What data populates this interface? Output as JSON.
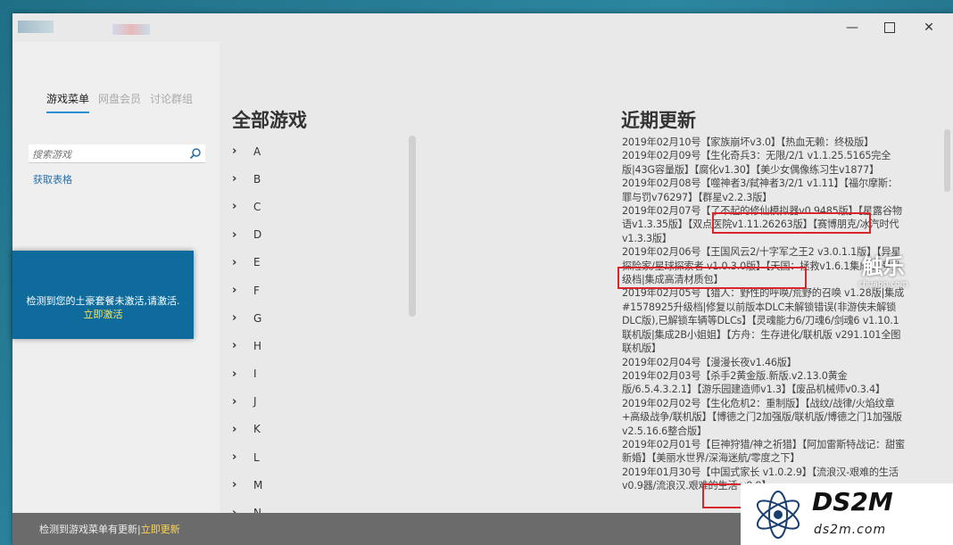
{
  "window": {
    "controls": {
      "minimize": "—",
      "close": "✕"
    }
  },
  "sidebar": {
    "tabs": [
      {
        "label": "游戏菜单",
        "active": true
      },
      {
        "label": "网盘会员",
        "active": false
      },
      {
        "label": "讨论群组",
        "active": false
      }
    ],
    "search_placeholder": "搜索游戏",
    "get_table_label": "获取表格",
    "activation": {
      "message": "检测到您的土豪套餐未激活,请激活.",
      "link": "立即激活"
    }
  },
  "games": {
    "title": "全部游戏",
    "letters": [
      "A",
      "B",
      "C",
      "D",
      "E",
      "F",
      "G",
      "H",
      "I",
      "J",
      "K",
      "L",
      "M",
      "N"
    ]
  },
  "updates": {
    "title": "近期更新",
    "items": [
      "2019年02月10号【家族崩坏v3.0】【热血无赖：终极版】",
      "2019年02月09号【生化奇兵3：无限/2/1 v1.1.25.5165完全版|43G容量版】【腐化v1.30】【美少女偶像练习生v1877】",
      "2019年02月08号【噬神者3/弑神者3/2/1 v1.11】【福尔摩斯：罪与罚v76297】【群星v2.2.3版】",
      "2019年02月07号【了不起的修仙模拟器v0.9485版】【星露谷物语v1.3.35版】【双点医院v1.11.26263版】【赛博朋克/冰汽时代v1.3.3版】",
      "2019年02月06号【王国风云2/十字军之王2 v3.0.1.1版】【异星探险家/星球探索者 v1.0.3.0版】【天国：拯救v1.6.1集成22号升级档|集成高清材质包】",
      "2019年02月05号【猎人：野性的呼唤/荒野的召唤 v1.28版|集成#1578925升级档|修复以前版本DLC未解锁错误(非游侠未解锁DLC版),已解锁车辆等DLCs】【灵魂能力6/刀魂6/剑魂6 v1.10.1联机版|集成2B小姐姐】【方舟：生存进化/联机版 v291.101全图联机版】",
      "2019年02月04号【漫漫长夜v1.46版】",
      "2019年02月03号【杀手2黄金版.新版.v2.13.0黄金版/6.5.4.3.2.1】【游乐园建造师v1.3】【废品机械师v0.3.4】",
      "2019年02月02号【生化危机2：重制版】【战纹/战律/火焰纹章+高级战争/联机版】【博德之门2加强版/联机版/博德之门1加强版 v2.5.16.6整合版】",
      "2019年02月01号【巨神狩猎/神之祈猎】【阿加雷斯特战记：甜蜜新婚】【美丽水世界/深海迷航/零度之下】",
      "2019年01月30号【中国式家长 v1.0.2.9】【流浪汉-艰难的生活 v0.9器/流浪汉.艰难的生活 v0.9】"
    ]
  },
  "footer": {
    "message": "检测到游戏菜单有更新|",
    "link": "立即更新"
  },
  "watermarks": {
    "chuapp_big": "触乐",
    "chuapp_small": "chuapp.com",
    "ds2m_big": "DS2M",
    "ds2m_small": "ds2m.com"
  }
}
